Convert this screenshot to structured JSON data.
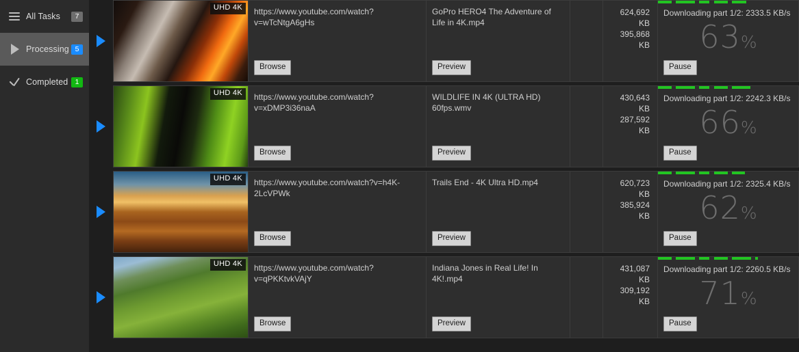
{
  "sidebar": {
    "items": [
      {
        "label": "All Tasks",
        "count": "7",
        "icon": "hamburger-icon",
        "badge_color": "#6e6e6e",
        "active": false
      },
      {
        "label": "Processing",
        "count": "5",
        "icon": "play-icon",
        "badge_color": "#1a8cff",
        "active": true
      },
      {
        "label": "Completed",
        "count": "1",
        "icon": "check-icon",
        "badge_color": "#12b812",
        "active": false
      }
    ]
  },
  "table": {
    "rows": [
      {
        "quality_badge": "UHD 4K",
        "url": "https://www.youtube.com/watch?v=wTcNtgA6gHs",
        "filename": "GoPro HERO4  The Adventure of Life in 4K.mp4",
        "size_total": "624,692 KB",
        "size_done": "395,868 KB",
        "status": "Downloading part 1/2: 2333.5 KB/s",
        "percent": "63",
        "percent_symbol": "%",
        "progress_value": 63,
        "browse_label": "Browse",
        "preview_label": "Preview",
        "pause_label": "Pause",
        "thumb_css": "linear-gradient(118deg, #120d0b 0%, #2a1a12 14%, #8a7f76 25%, #c6bcb2 34%, #6d5a49 44%, #241610 54%, #8a2f08 64%, #f06a10 72%, #ffa827 78%, #c2490a 85%, #3a1c0d 93%, #140b06 100%)"
      },
      {
        "quality_badge": "UHD 4K",
        "url": "https://www.youtube.com/watch?v=xDMP3i36naA",
        "filename": "WILDLIFE IN 4K (ULTRA HD) 60fps.wmv",
        "size_total": "430,643 KB",
        "size_done": "287,592 KB",
        "status": "Downloading part 1/2: 2242.3 KB/s",
        "percent": "66",
        "percent_symbol": "%",
        "progress_value": 66,
        "browse_label": "Browse",
        "preview_label": "Preview",
        "pause_label": "Pause",
        "thumb_css": "linear-gradient(100deg, #2b4a12 0%, #56871a 12%, #8cc41f 24%, #121a0c 38%, #0a0a08 50%, #1d2a10 60%, #4f8c16 72%, #8fd223 84%, #5d9a18 94%, #24400f 100%)"
      },
      {
        "quality_badge": "UHD 4K",
        "url": "https://www.youtube.com/watch?v=h4K-2LcVPWk",
        "filename": "Trails End - 4K Ultra HD.mp4",
        "size_total": "620,723 KB",
        "size_done": "385,924 KB",
        "status": "Downloading part 1/2: 2325.4 KB/s",
        "percent": "62",
        "percent_symbol": "%",
        "progress_value": 62,
        "browse_label": "Browse",
        "preview_label": "Preview",
        "pause_label": "Pause",
        "thumb_css": "linear-gradient(180deg, #2a5e86 0%, #6f93a8 16%, #d9a14f 30%, #f0c067 38%, #a9641f 50%, #8c4a17 62%, #b46a22 74%, #7a3e14 86%, #46230d 100%)"
      },
      {
        "quality_badge": "UHD 4K",
        "url": "https://www.youtube.com/watch?v=qPKKtvkVAjY",
        "filename": "Indiana Jones in Real Life! In 4K!.mp4",
        "size_total": "431,087 KB",
        "size_done": "309,192 KB",
        "status": "Downloading part 1/2: 2260.5 KB/s",
        "percent": "71",
        "percent_symbol": "%",
        "progress_value": 71,
        "browse_label": "Browse",
        "preview_label": "Preview",
        "pause_label": "Pause",
        "thumb_css": "linear-gradient(165deg, #7fa8c8 0%, #9bbcd4 10%, #6f8f5a 22%, #4f7a2c 34%, #6d9a30 48%, #86b23a 62%, #5c8a26 76%, #3f6a1c 88%, #2d4f14 100%)"
      }
    ]
  },
  "colors": {
    "accent_blue": "#1a8cff",
    "progress_green": "#22c522",
    "completed_green": "#12b812",
    "sidebar_bg": "#2b2b2b",
    "content_bg": "#1e1e1e",
    "row_bg": "#2e2e2e"
  }
}
